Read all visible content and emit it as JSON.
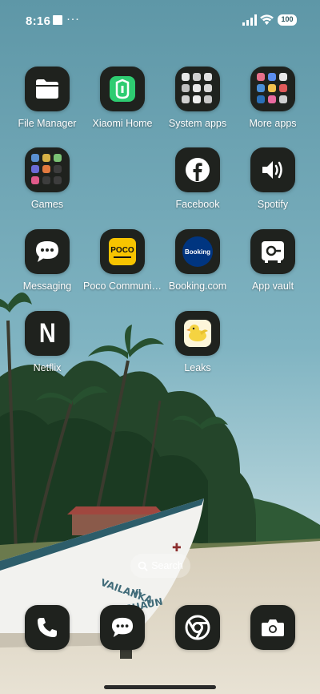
{
  "status_bar": {
    "time": "8:16",
    "more": "···",
    "battery": "100"
  },
  "apps": [
    {
      "label": "File Manager",
      "icon": "folder-icon"
    },
    {
      "label": "Xiaomi Home",
      "icon": "xiaomi-home-icon"
    },
    {
      "label": "System apps",
      "icon": "folder-grid-icon"
    },
    {
      "label": "More apps",
      "icon": "folder-grid-icon"
    },
    {
      "label": "Games",
      "icon": "folder-grid-icon"
    },
    {
      "label": "Facebook",
      "icon": "facebook-icon"
    },
    {
      "label": "Spotify",
      "icon": "speaker-icon"
    },
    {
      "label": "Messaging",
      "icon": "chat-bubble-icon"
    },
    {
      "label": "Poco Communi…",
      "icon": "poco-icon",
      "badge_text": "POCO"
    },
    {
      "label": "Booking.com",
      "icon": "booking-icon",
      "badge_text": "Booking"
    },
    {
      "label": "App vault",
      "icon": "vault-icon"
    },
    {
      "label": "Netflix",
      "icon": "netflix-icon",
      "badge_text": "N"
    },
    {
      "label": "Leaks",
      "icon": "duck-icon"
    }
  ],
  "search": {
    "label": "Search"
  },
  "dock": [
    {
      "name": "phone",
      "icon": "phone-icon"
    },
    {
      "name": "messages",
      "icon": "chat-bubble-icon"
    },
    {
      "name": "chrome",
      "icon": "chrome-icon"
    },
    {
      "name": "camera",
      "icon": "camera-icon"
    }
  ],
  "colors": {
    "icon_bg": "#1f221e",
    "xiaomi_green": "#2ecc71",
    "poco_yellow": "#f7c400",
    "booking_blue": "#003580",
    "leaks_yellow": "#f5d341",
    "sky": "#6fa5b3"
  }
}
